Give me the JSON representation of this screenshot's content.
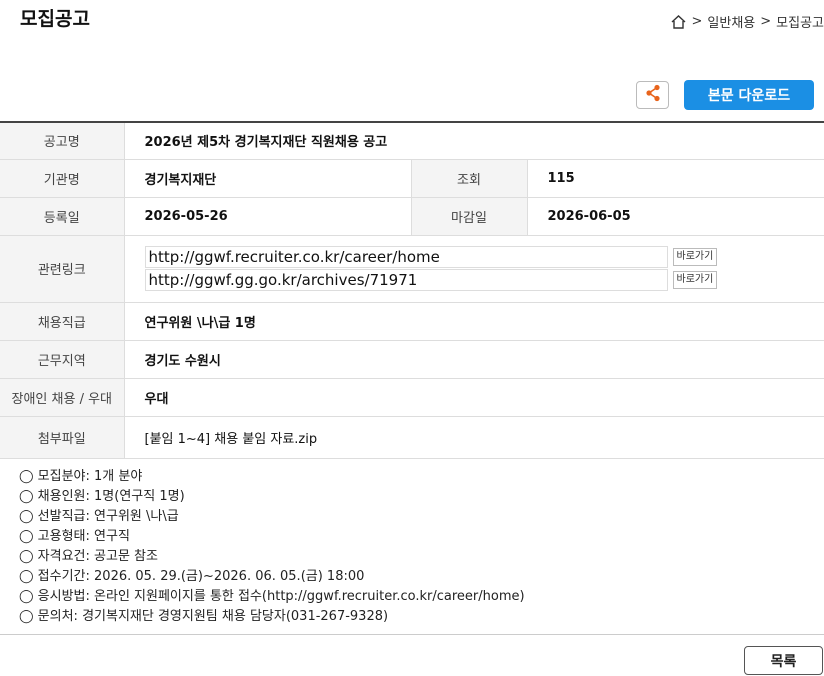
{
  "page_title": "모집공고",
  "breadcrumb": {
    "items": [
      ">",
      "일반채용",
      ">",
      "모집공고"
    ]
  },
  "toolbar": {
    "download_label": "본문 다운로드"
  },
  "info": {
    "title_label": "공고명",
    "title_value": "2026년 제5차 경기복지재단 직원채용 공고",
    "org_label": "기관명",
    "org_value": "경기복지재단",
    "views_label": "조회",
    "views_value": "115",
    "reg_label": "등록일",
    "reg_value": "2026-05-26",
    "deadline_label": "마감일",
    "deadline_value": "2026-06-05",
    "links_label": "관련링크",
    "links": [
      {
        "url": "http://ggwf.recruiter.co.kr/career/home",
        "go": "바로가기"
      },
      {
        "url": "http://ggwf.gg.go.kr/archives/71971",
        "go": "바로가기"
      }
    ],
    "position_label": "채용직급",
    "position_value": "연구위원 \\나\\급 1명",
    "location_label": "근무지역",
    "location_value": "경기도 수원시",
    "disability_label": "장애인 채용 / 우대",
    "disability_value": "우대",
    "attach_label": "첨부파일",
    "attach_value": "[붙임 1~4] 채용 붙임 자료.zip"
  },
  "details": [
    "◯ 모집분야: 1개 분야",
    "◯ 채용인원: 1명(연구직 1명)",
    "◯ 선발직급: 연구위원 \\나\\급",
    "◯ 고용형태: 연구직",
    "◯ 자격요건: 공고문 참조",
    "◯ 접수기간: 2026. 05. 29.(금)~2026. 06. 05.(금) 18:00",
    "◯ 응시방법: 온라인 지원페이지를 통한 접수(http://ggwf.recruiter.co.kr/career/home)",
    "◯ 문의처: 경기복지재단 경영지원팀 채용 담당자(031-267-9328)"
  ],
  "list_button": "목록",
  "colors": {
    "accent": "#1b8fe4",
    "share_icon": "#e8641c"
  }
}
